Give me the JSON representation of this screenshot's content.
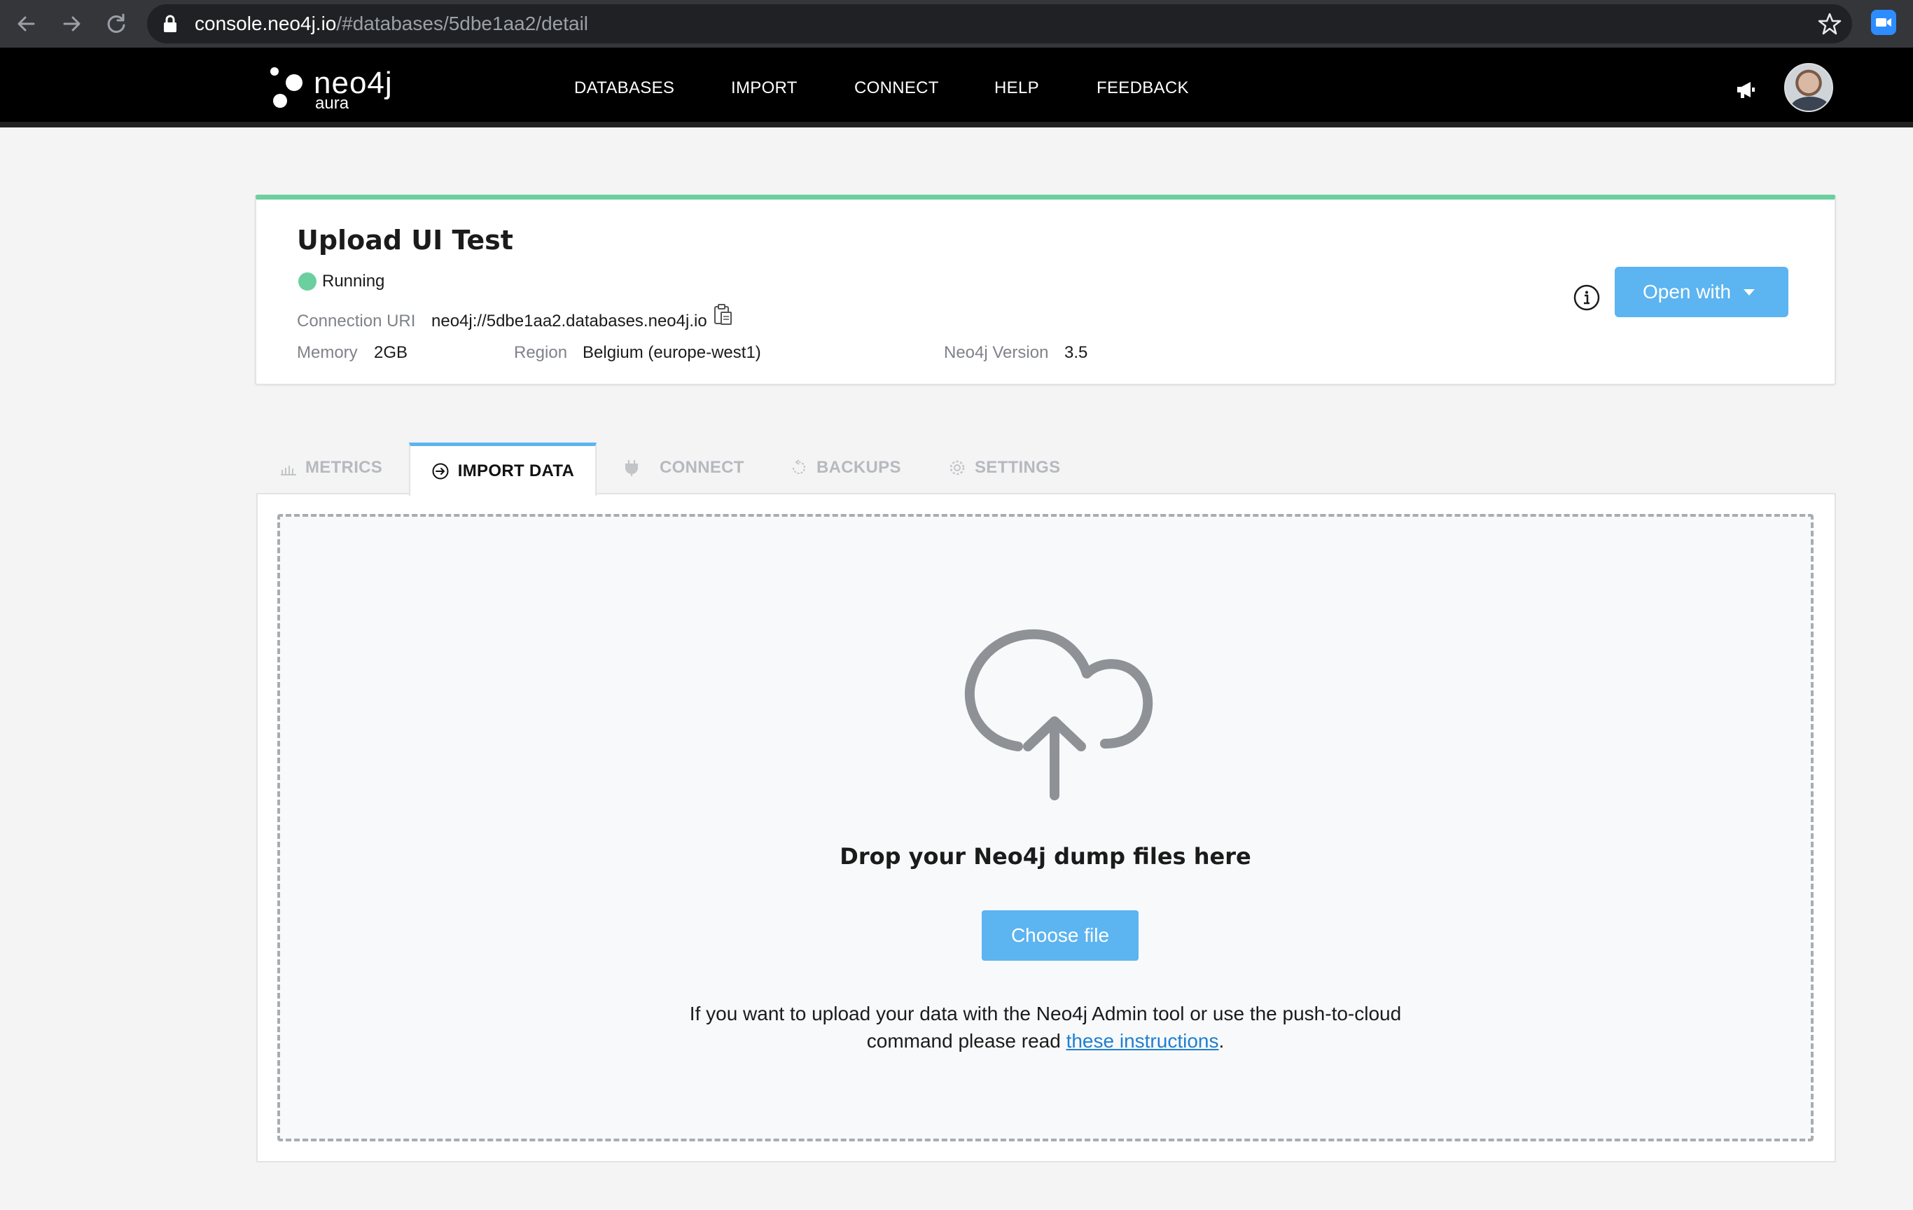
{
  "browser": {
    "url_domain": "console.neo4j.io",
    "url_path": "/#databases/5dbe1aa2/detail"
  },
  "header": {
    "logo_word": "neo4j",
    "logo_sub": "aura",
    "nav": [
      "DATABASES",
      "IMPORT",
      "CONNECT",
      "HELP",
      "FEEDBACK"
    ]
  },
  "database": {
    "name": "Upload UI Test",
    "status": "Running",
    "connection_uri_label": "Connection URI",
    "connection_uri": "neo4j://5dbe1aa2.databases.neo4j.io",
    "memory_label": "Memory",
    "memory": "2GB",
    "region_label": "Region",
    "region": "Belgium (europe-west1)",
    "version_label": "Neo4j Version",
    "version": "3.5",
    "open_with_label": "Open with"
  },
  "tabs": [
    "METRICS",
    "IMPORT DATA",
    "CONNECT",
    "BACKUPS",
    "SETTINGS"
  ],
  "import": {
    "drop_title": "Drop your Neo4j dump files here",
    "choose_label": "Choose file",
    "help_line1": "If you want to upload your data with the Neo4j Admin tool or use the push-to-cloud",
    "help_line2_before": "command please read ",
    "help_link": "these instructions",
    "help_line2_after": "."
  },
  "colors": {
    "accent": "#5cb4f0",
    "running": "#6ccf9f",
    "link": "#1f7fd1"
  }
}
